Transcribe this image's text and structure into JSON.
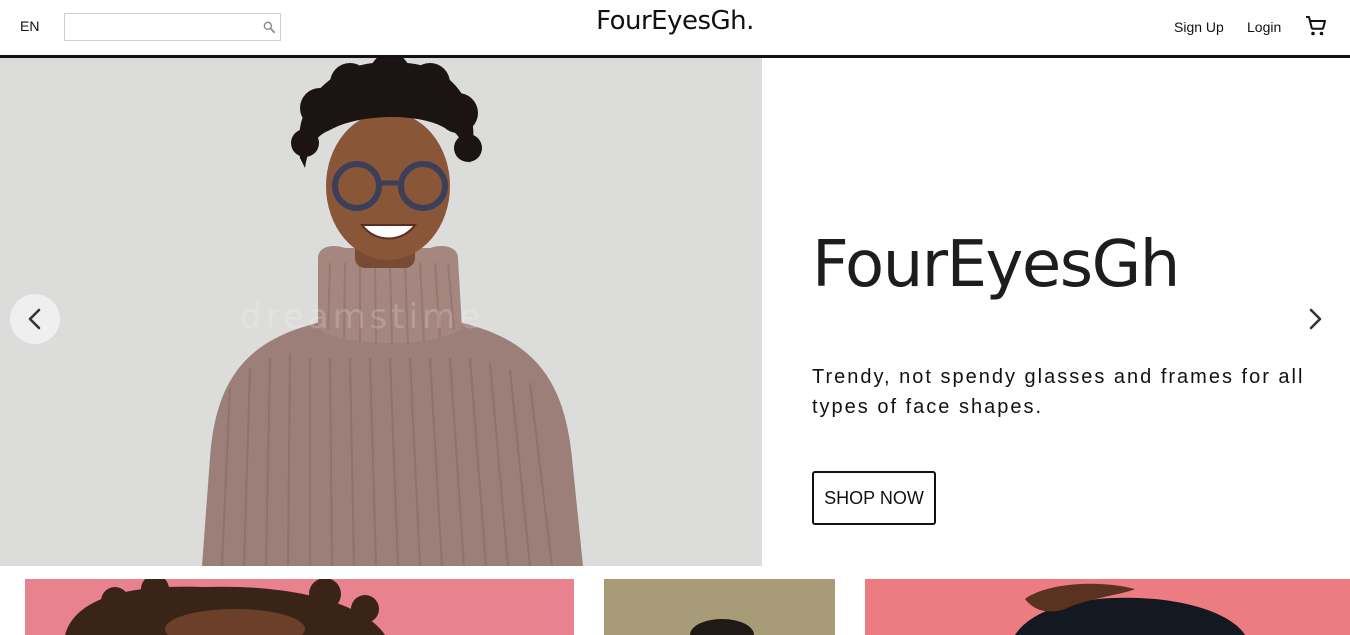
{
  "header": {
    "language": "EN",
    "search": {
      "placeholder": "",
      "value": ""
    },
    "logo": "FourEyesGh.",
    "nav": {
      "sign_up": "Sign Up",
      "login": "Login"
    },
    "icons": {
      "search": "search-icon",
      "cart": "shopping-cart-icon"
    }
  },
  "hero": {
    "title": "FourEyesGh",
    "tagline": "Trendy, not spendy glasses and frames for all types of face shapes.",
    "cta_label": "SHOP NOW",
    "image_alt": "Smiling woman wearing round glasses and a turtleneck sweater",
    "controls": {
      "prev": "chevron-left-icon",
      "next": "chevron-right-icon"
    }
  },
  "products": [
    {
      "name": "product-card-1",
      "bg": "#e8828f"
    },
    {
      "name": "product-card-2",
      "bg": "#a79b78"
    },
    {
      "name": "product-card-3",
      "bg": "#ec7b82"
    }
  ],
  "colors": {
    "text": "#111111",
    "hero_bg": "#dcdcda",
    "border": "#111111"
  }
}
